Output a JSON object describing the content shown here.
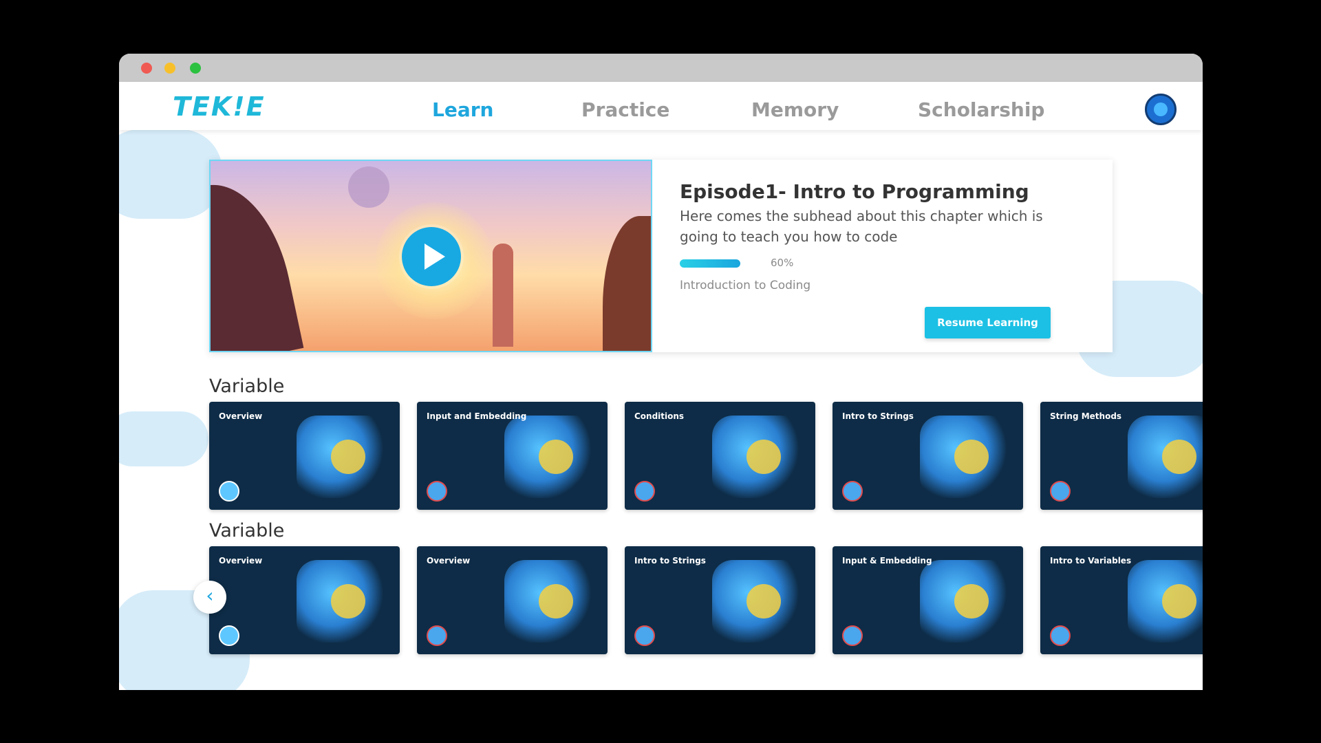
{
  "app": {
    "logo": "TEK!E"
  },
  "nav": {
    "items": [
      {
        "label": "Learn",
        "active": true
      },
      {
        "label": "Practice",
        "active": false
      },
      {
        "label": "Memory",
        "active": false
      },
      {
        "label": "Scholarship",
        "active": false
      }
    ]
  },
  "hero": {
    "title": "Episode1- Intro to Programming",
    "subtitle": "Here comes the subhead about this chapter which is going to teach you how to code",
    "progress_value": 0.6,
    "progress_label": "60%",
    "course": "Introduction to Coding",
    "resume_label": "Resume Learning"
  },
  "sections": [
    {
      "title": "Variable",
      "cards": [
        {
          "label": "Overview",
          "status": "unlocked"
        },
        {
          "label": "Input and Embedding",
          "status": "locked"
        },
        {
          "label": "Conditions",
          "status": "locked"
        },
        {
          "label": "Intro to Strings",
          "status": "locked"
        },
        {
          "label": "String Methods",
          "status": "locked"
        }
      ]
    },
    {
      "title": "Variable",
      "cards": [
        {
          "label": "Overview",
          "status": "unlocked"
        },
        {
          "label": "Overview",
          "status": "locked"
        },
        {
          "label": "Intro to Strings",
          "status": "locked"
        },
        {
          "label": "Input & Embedding",
          "status": "locked"
        },
        {
          "label": "Intro to Variables",
          "status": "locked"
        }
      ]
    }
  ],
  "colors": {
    "accent": "#1ea6dd",
    "card_bg": "#0e2c47",
    "button": "#1cc0e4"
  },
  "icons": {
    "play": "play-icon",
    "back": "chevron-left-icon",
    "avatar": "avatar-icon"
  }
}
